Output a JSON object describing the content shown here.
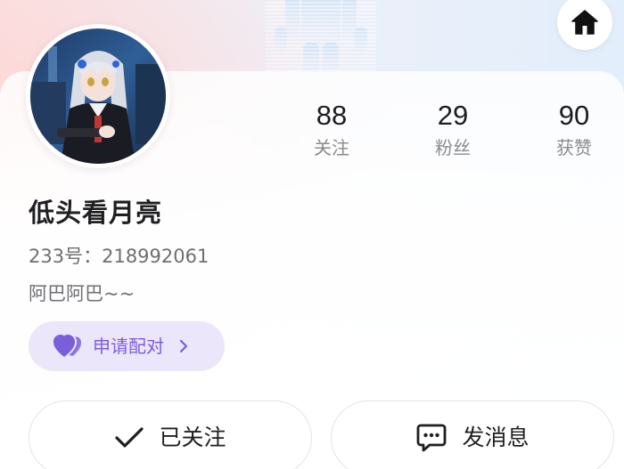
{
  "header": {
    "home_icon": "home-icon"
  },
  "profile": {
    "nickname": "低头看月亮",
    "uid_label": "233号：",
    "uid_value": "218992061",
    "bio": "阿巴阿巴~~"
  },
  "stats": [
    {
      "value": "88",
      "label": "关注"
    },
    {
      "value": "29",
      "label": "粉丝"
    },
    {
      "value": "90",
      "label": "获赞"
    }
  ],
  "match": {
    "label": "申请配对",
    "icon": "double-heart-icon"
  },
  "actions": {
    "follow_label": "已关注",
    "follow_icon": "check-icon",
    "message_label": "发消息",
    "message_icon": "chat-bubble-icon"
  },
  "colors": {
    "accent_purple": "#7a60d8",
    "pill_bg": "#ece6fa",
    "text_primary": "#1f1f22",
    "text_secondary": "#6e6e73"
  }
}
